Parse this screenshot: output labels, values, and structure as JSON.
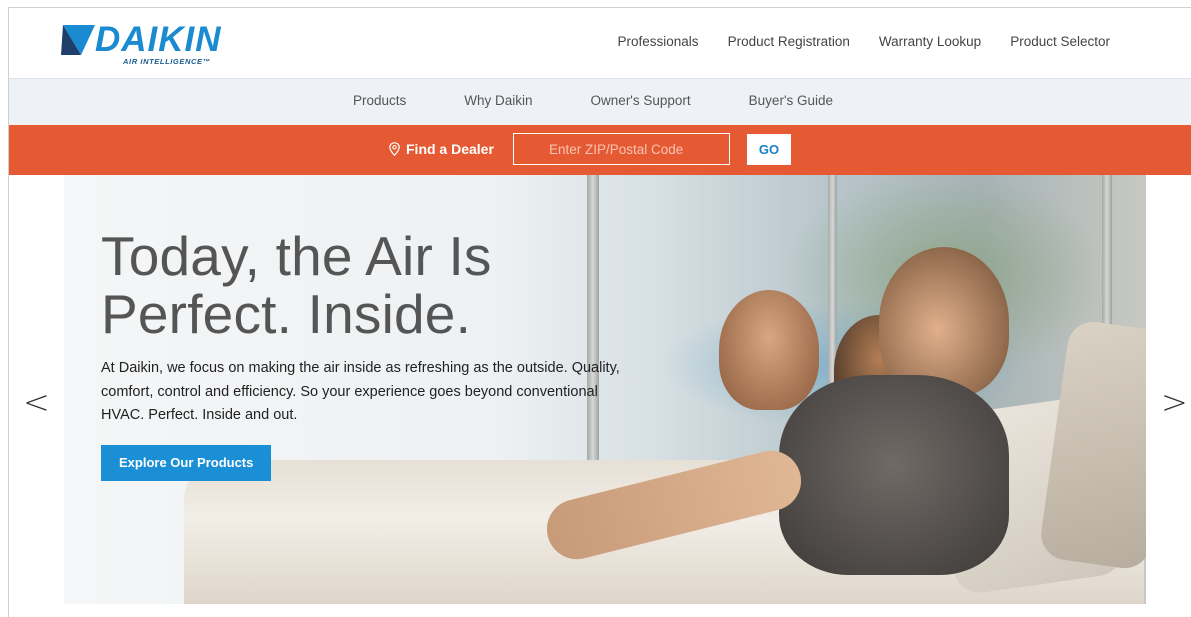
{
  "brand": {
    "name": "DAIKIN",
    "tagline": "AIR INTELLIGENCE™",
    "colors": {
      "blue": "#1b8bd1",
      "dark": "#1f3f6b",
      "orange": "#e55a33"
    }
  },
  "utility_nav": [
    "Professionals",
    "Product Registration",
    "Warranty Lookup",
    "Product Selector"
  ],
  "main_nav": [
    "Products",
    "Why Daikin",
    "Owner's Support",
    "Buyer's Guide"
  ],
  "dealer": {
    "icon": "map-pin-icon",
    "label": "Find a Dealer",
    "placeholder": "Enter ZIP/Postal Code",
    "button": "GO"
  },
  "hero": {
    "headline_line1": "Today, the Air Is",
    "headline_line2": "Perfect. Inside.",
    "body": "At Daikin, we focus on making the air inside as refreshing as the outside. Quality, comfort, control and efficiency. So your experience goes beyond conventional HVAC. Perfect. Inside and out.",
    "cta": "Explore Our Products"
  },
  "carousel": {
    "prev": "<",
    "next": ">"
  }
}
